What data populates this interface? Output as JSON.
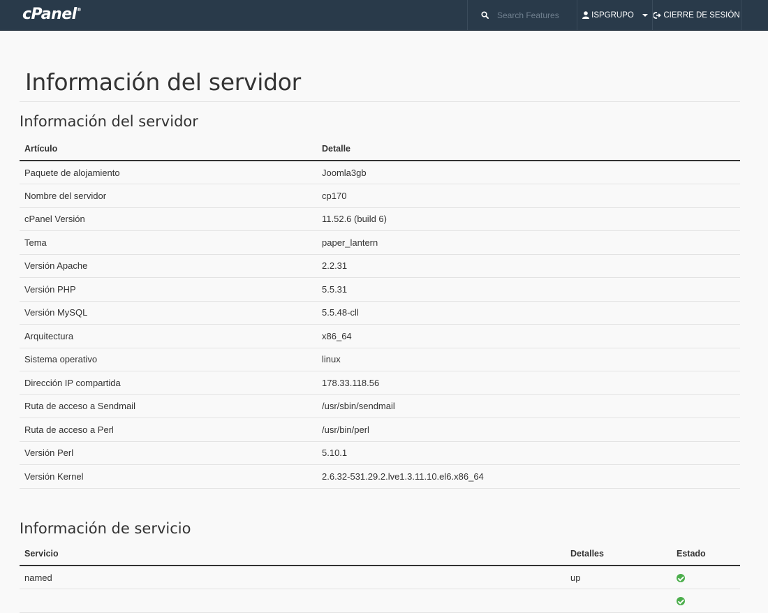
{
  "topbar": {
    "logo": "cPanel",
    "logo_mark": "®",
    "search_placeholder": "Search Features",
    "user": "ISPGRUPO",
    "logout": "CIERRE DE SESIÓN"
  },
  "page_title": "Información del servidor",
  "server_section": {
    "title": "Información del servidor",
    "headers": [
      "Artículo",
      "Detalle"
    ],
    "rows": [
      [
        "Paquete de alojamiento",
        "Joomla3gb"
      ],
      [
        "Nombre del servidor",
        "cp170"
      ],
      [
        "cPanel Versión",
        "11.52.6 (build 6)"
      ],
      [
        "Tema",
        "paper_lantern"
      ],
      [
        "Versión Apache",
        "2.2.31"
      ],
      [
        "Versión PHP",
        "5.5.31"
      ],
      [
        "Versión MySQL",
        "5.5.48-cll"
      ],
      [
        "Arquitectura",
        "x86_64"
      ],
      [
        "Sistema operativo",
        "linux"
      ],
      [
        "Dirección IP compartida",
        "178.33.118.56"
      ],
      [
        "Ruta de acceso a Sendmail",
        "/usr/sbin/sendmail"
      ],
      [
        "Ruta de acceso a Perl",
        "/usr/bin/perl"
      ],
      [
        "Versión Perl",
        "5.10.1"
      ],
      [
        "Versión Kernel",
        "2.6.32-531.29.2.lve1.3.11.10.el6.x86_64"
      ]
    ]
  },
  "service_section": {
    "title": "Información de servicio",
    "headers": [
      "Servicio",
      "Detalles",
      "Estado"
    ],
    "rows": [
      {
        "service": "named",
        "details": "up",
        "status": "ok"
      },
      {
        "service": "",
        "details": "",
        "status": "ok"
      }
    ]
  },
  "colors": {
    "topbar": "#293a4a",
    "status_ok": "#4cae4c"
  }
}
